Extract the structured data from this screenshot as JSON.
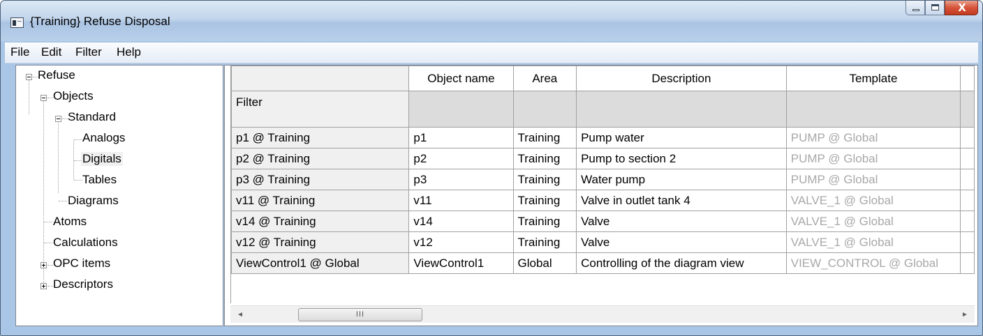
{
  "window": {
    "title": "{Training} Refuse Disposal",
    "close_glyph": "X"
  },
  "menu": [
    "File",
    "Edit",
    "Filter",
    "Help"
  ],
  "tree": {
    "root": "Refuse",
    "objects": "Objects",
    "standard": "Standard",
    "analogs": "Analogs",
    "digitals": "Digitals",
    "tables": "Tables",
    "diagrams": "Diagrams",
    "atoms": "Atoms",
    "calculations": "Calculations",
    "opc_items": "OPC items",
    "descriptors": "Descriptors",
    "selected": "Digitals"
  },
  "grid": {
    "columns": [
      "Object name",
      "Area",
      "Description",
      "Template"
    ],
    "filter_label": "Filter",
    "rows": [
      {
        "header": "p1 @ Training",
        "object_name": "p1",
        "area": "Training",
        "description": "Pump water",
        "template": "PUMP @ Global"
      },
      {
        "header": "p2 @ Training",
        "object_name": "p2",
        "area": "Training",
        "description": "Pump to section 2",
        "template": "PUMP @ Global"
      },
      {
        "header": "p3 @ Training",
        "object_name": "p3",
        "area": "Training",
        "description": "Water pump",
        "template": "PUMP @ Global"
      },
      {
        "header": "v11 @ Training",
        "object_name": "v11",
        "area": "Training",
        "description": "Valve in outlet tank 4",
        "template": "VALVE_1 @ Global"
      },
      {
        "header": "v14 @ Training",
        "object_name": "v14",
        "area": "Training",
        "description": "Valve",
        "template": "VALVE_1 @ Global"
      },
      {
        "header": "v12 @ Training",
        "object_name": "v12",
        "area": "Training",
        "description": "Valve",
        "template": "VALVE_1 @ Global"
      },
      {
        "header": "ViewControl1 @ Global",
        "object_name": "ViewControl1",
        "area": "Global",
        "description": "Controlling of the diagram view",
        "template": "VIEW_CONTROL @ Global"
      }
    ]
  },
  "scrollbar": {
    "left_arrow": "◄",
    "right_arrow": "►",
    "thumb_grip": "III"
  },
  "icons": {
    "app": "app-window-icon",
    "expanded": "minus-box-icon",
    "collapsed": "plus-box-icon"
  }
}
